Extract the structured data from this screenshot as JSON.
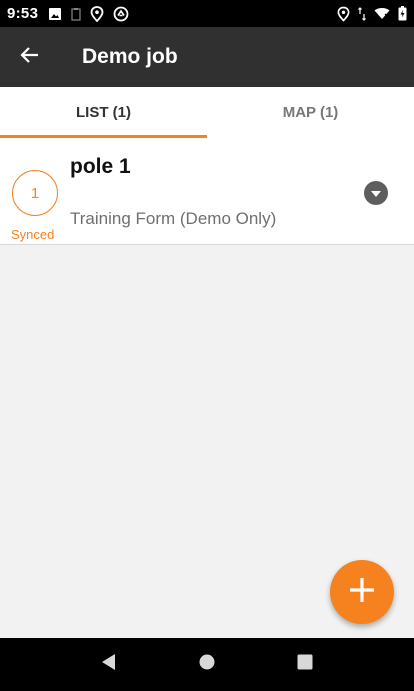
{
  "status_bar": {
    "time": "9:53",
    "left_icons": [
      "image-icon",
      "clipboard-icon",
      "location-pin-icon",
      "sync-app-icon"
    ],
    "right_icons": [
      "location-pin-icon",
      "data-arrows-icon",
      "wifi-icon",
      "battery-icon"
    ]
  },
  "app_bar": {
    "title": "Demo job",
    "background": "#303030"
  },
  "tabs": [
    {
      "label": "LIST (1)",
      "active": true
    },
    {
      "label": "MAP (1)",
      "active": false
    }
  ],
  "list": {
    "items": [
      {
        "badge_number": "1",
        "status": "Synced",
        "title": "pole 1",
        "subtitle": "Training Form (Demo Only)"
      }
    ]
  },
  "colors": {
    "accent": "#f5821f",
    "app_bar": "#303030",
    "background": "#f2f2f2"
  }
}
